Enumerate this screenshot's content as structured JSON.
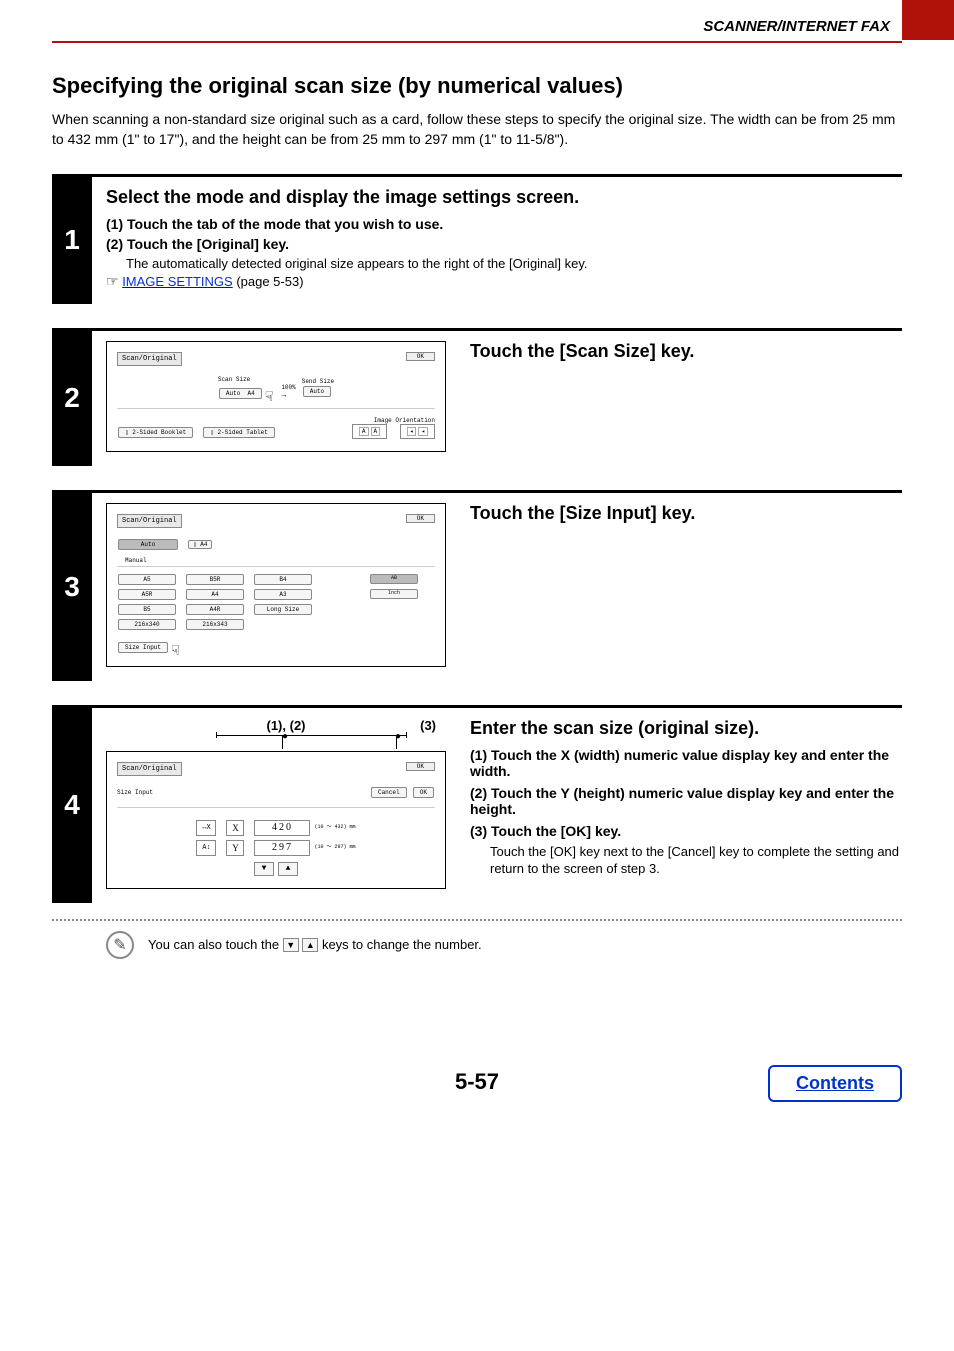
{
  "header": {
    "category": "SCANNER/INTERNET FAX"
  },
  "title": "Specifying the original scan size (by numerical values)",
  "intro": "When scanning a non-standard size original such as a card, follow these steps to specify the original size. The width can be from 25 mm to 432 mm (1\" to 17\"), and the height can be from 25 mm to 297 mm (1\" to 11-5/8\").",
  "step1": {
    "num": "1",
    "heading": "Select the mode and display the image settings screen.",
    "line1": "(1)   Touch the tab of the mode that you wish to use.",
    "line2": "(2)   Touch the [Original] key.",
    "note": "The automatically detected original size appears to the right of the [Original] key.",
    "link_text": "IMAGE SETTINGS",
    "link_suffix": " (page 5-53)"
  },
  "step2": {
    "num": "2",
    "heading": "Touch the [Scan Size] key.",
    "panel": {
      "title": "Scan/Original",
      "ok": "OK",
      "scan_size_label": "Scan Size",
      "percent": "100%",
      "send_size_label": "Send Size",
      "auto": "Auto",
      "a4": "A4",
      "auto2": "Auto",
      "two_sided_booklet": "2-Sided Booklet",
      "two_sided_tablet": "2-Sided Tablet",
      "image_orientation": "Image Orientation"
    }
  },
  "step3": {
    "num": "3",
    "heading": "Touch the [Size Input] key.",
    "panel": {
      "title": "Scan/Original",
      "ok": "OK",
      "auto": "Auto",
      "a4tab": "A4",
      "manual": "Manual",
      "a5": "A5",
      "b5r": "B5R",
      "b4": "B4",
      "ab_inch_top": "AB",
      "a5r": "A5R",
      "a4": "A4",
      "a3": "A3",
      "ab_inch_bottom": "Inch",
      "b5": "B5",
      "a4r": "A4R",
      "long_size": "Long Size",
      "s216x340": "216x340",
      "s216x343": "216x343",
      "size_input": "Size Input"
    }
  },
  "step4": {
    "num": "4",
    "heading": "Enter the scan size (original size).",
    "annot12": "(1), (2)",
    "annot3": "(3)",
    "sub1": "(1)   Touch the X (width) numeric value display key and enter the width.",
    "sub2": "(2)   Touch the Y (height) numeric value display key and enter the height.",
    "sub3": "(3)   Touch the [OK] key.",
    "sub3_note": "Touch the [OK] key next to the [Cancel] key to complete the setting and return to the screen of step 3.",
    "panel": {
      "title": "Scan/Original",
      "ok_top": "OK",
      "size_input": "Size Input",
      "cancel": "Cancel",
      "ok": "OK",
      "x_label": "X",
      "x_val": "420",
      "x_range": "(10 ～ 432)\nmm",
      "y_label": "Y",
      "y_val": "297",
      "y_range": "(10 ～ 297)\nmm"
    }
  },
  "tip": {
    "pre": "You can also touch the ",
    "post": " keys to change the number."
  },
  "footer": {
    "page_num": "5-57",
    "contents": "Contents"
  }
}
